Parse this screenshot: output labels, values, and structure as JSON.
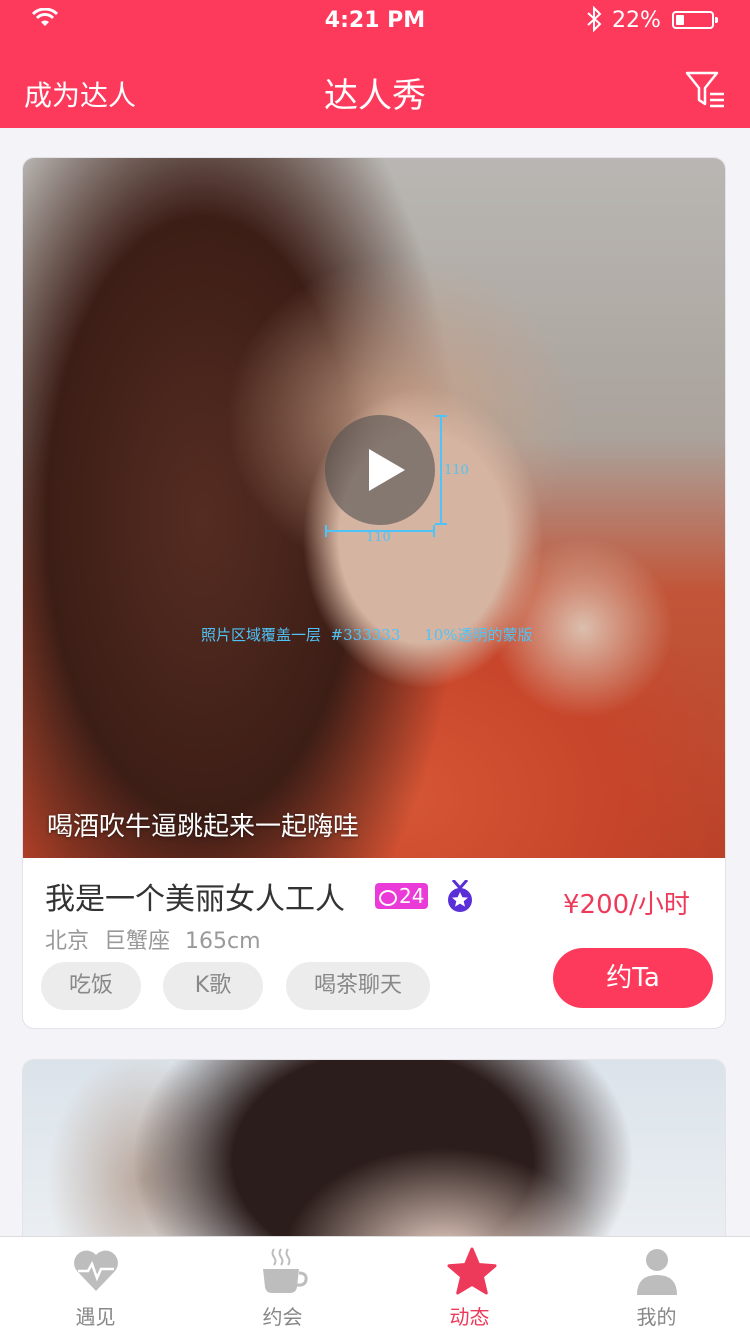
{
  "status_bar": {
    "time": "4:21 PM",
    "battery_pct": "22%",
    "battery_level": 0.22
  },
  "nav": {
    "left_label": "成为达人",
    "title": "达人秀",
    "filter_icon": "filter-icon"
  },
  "cards": [
    {
      "annotation_height": "110",
      "annotation_width": "110",
      "annotation_note": "照片区域覆盖一层  #333333     10%透明的蒙版",
      "caption": "喝酒吹牛逼跳起来一起嗨哇",
      "name": "我是一个美丽女人工人",
      "message_count": "24",
      "price": "¥200/小时",
      "location": "北京",
      "zodiac": "巨蟹座",
      "height": "165cm",
      "tags": [
        "吃饭",
        "K歌",
        "喝茶聊天"
      ],
      "book_label": "约Ta"
    }
  ],
  "tabs": [
    {
      "label": "遇见",
      "icon": "heart-pulse-icon"
    },
    {
      "label": "约会",
      "icon": "coffee-cup-icon"
    },
    {
      "label": "动态",
      "icon": "star-icon",
      "active": true
    },
    {
      "label": "我的",
      "icon": "person-icon"
    }
  ],
  "colors": {
    "brand": "#fd3a5c",
    "price": "#ee3a5a",
    "badge": "#ea3bd8",
    "annotation": "#4fc3f7"
  }
}
